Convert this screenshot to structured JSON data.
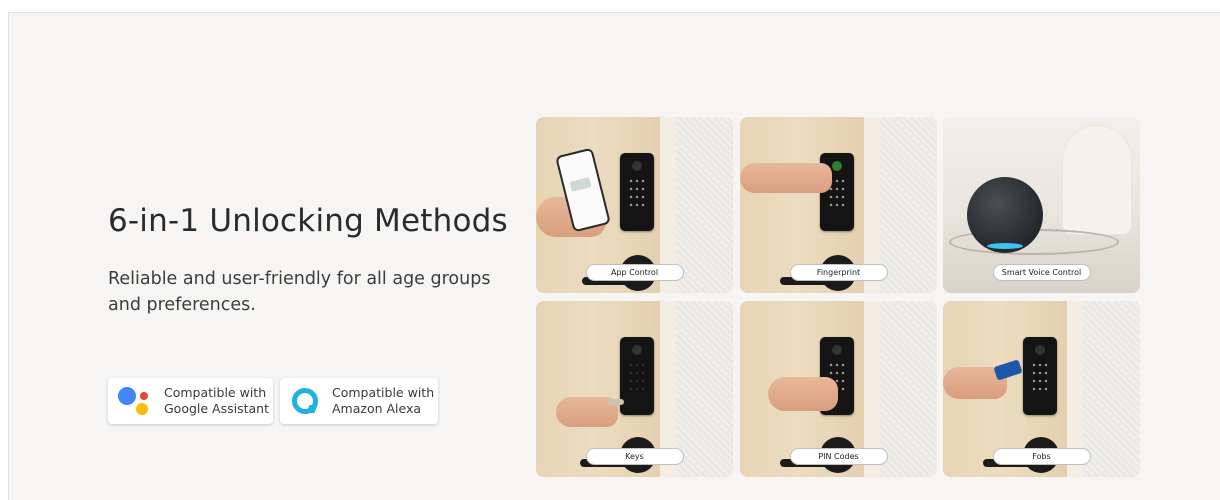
{
  "heading": "6-in-1 Unlocking Methods",
  "subheading": "Reliable and user-friendly for all age groups and preferences.",
  "badges": [
    {
      "line1": "Compatible with",
      "line2": "Google Assistant",
      "icon": "google-assistant-icon"
    },
    {
      "line1": "Compatible with",
      "line2": "Amazon Alexa",
      "icon": "amazon-alexa-icon"
    }
  ],
  "methods": [
    {
      "label": "App Control"
    },
    {
      "label": "Fingerprint"
    },
    {
      "label": "Smart Voice Control"
    },
    {
      "label": "Keys"
    },
    {
      "label": "PIN Codes"
    },
    {
      "label": "Fobs"
    }
  ],
  "colors": {
    "background": "#f6f5f3",
    "google_blue": "#4285f4",
    "google_red": "#ea4335",
    "google_yellow": "#fbbc05",
    "alexa_blue": "#1fb1e6"
  }
}
